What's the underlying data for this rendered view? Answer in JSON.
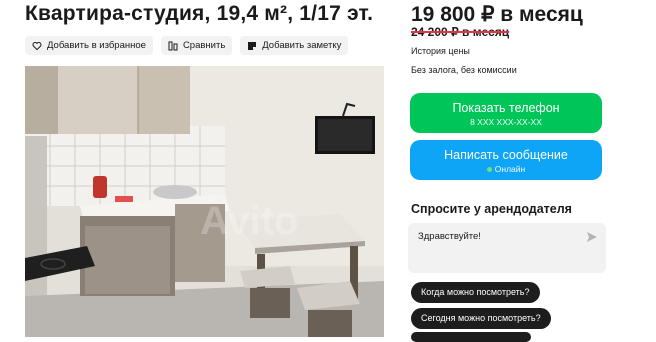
{
  "listing": {
    "title": "Квартира-студия, 19,4 м², 1/17 эт.",
    "actions": [
      {
        "label": "Добавить в избранное",
        "icon": "heart-icon"
      },
      {
        "label": "Сравнить",
        "icon": "compare-icon"
      },
      {
        "label": "Добавить заметку",
        "icon": "note-icon"
      }
    ],
    "photo_watermark": "Avito"
  },
  "sidebar": {
    "price": "19 800 ₽ в месяц",
    "old_price": "24 200 ₽ в месяц",
    "price_history": "История цены",
    "terms": "Без залога, без комиссии",
    "phone_button": {
      "label": "Показать телефон",
      "masked_number": "8 XXX XXX-XX-XX"
    },
    "message_button": {
      "label": "Написать сообщение",
      "status": "Онлайн"
    },
    "ask_heading": "Спросите у арендодателя",
    "message_input": {
      "value": "Здравствуйте!"
    },
    "quick_questions": [
      "Когда можно посмотреть?",
      "Сегодня можно посмотреть?"
    ]
  },
  "colors": {
    "green": "#00c65a",
    "blue": "#0ea5f7",
    "old_price_strike": "#e4344a",
    "chip_bg": "#1d1d1d"
  }
}
